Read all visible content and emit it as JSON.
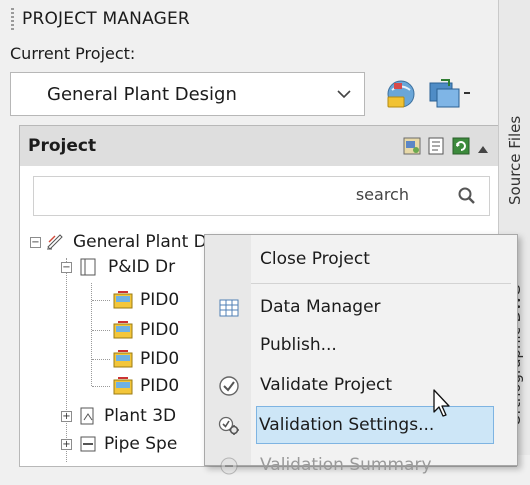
{
  "window": {
    "title": "PROJECT MANAGER"
  },
  "current_project": {
    "label": "Current Project:",
    "selected": "General Plant Design"
  },
  "project_panel": {
    "header": "Project",
    "search_placeholder": "search"
  },
  "tree": {
    "root": "General Plant Design",
    "pid_folder": "P&ID Dr",
    "pid_items": [
      "PID0",
      "PID0",
      "PID0",
      "PID0"
    ],
    "plant3d": "Plant 3D",
    "pipespec": "Pipe Spe"
  },
  "side_tabs": [
    "Source Files",
    "Orthographic DWG"
  ],
  "context_menu": {
    "items": [
      {
        "label": "Close Project",
        "icon": ""
      },
      {
        "label": "Data Manager",
        "icon": "data-manager-icon"
      },
      {
        "label": "Publish...",
        "icon": ""
      },
      {
        "label": "Validate Project",
        "icon": "validate-icon"
      },
      {
        "label": "Validation Settings...",
        "icon": "validation-settings-icon",
        "highlighted": true
      },
      {
        "label": "Validation Summary",
        "icon": "validation-summary-icon",
        "disabled": true
      }
    ]
  },
  "colors": {
    "highlight": "#cde6f7",
    "highlight_border": "#7eb4e2",
    "panel_header": "#dedede"
  }
}
